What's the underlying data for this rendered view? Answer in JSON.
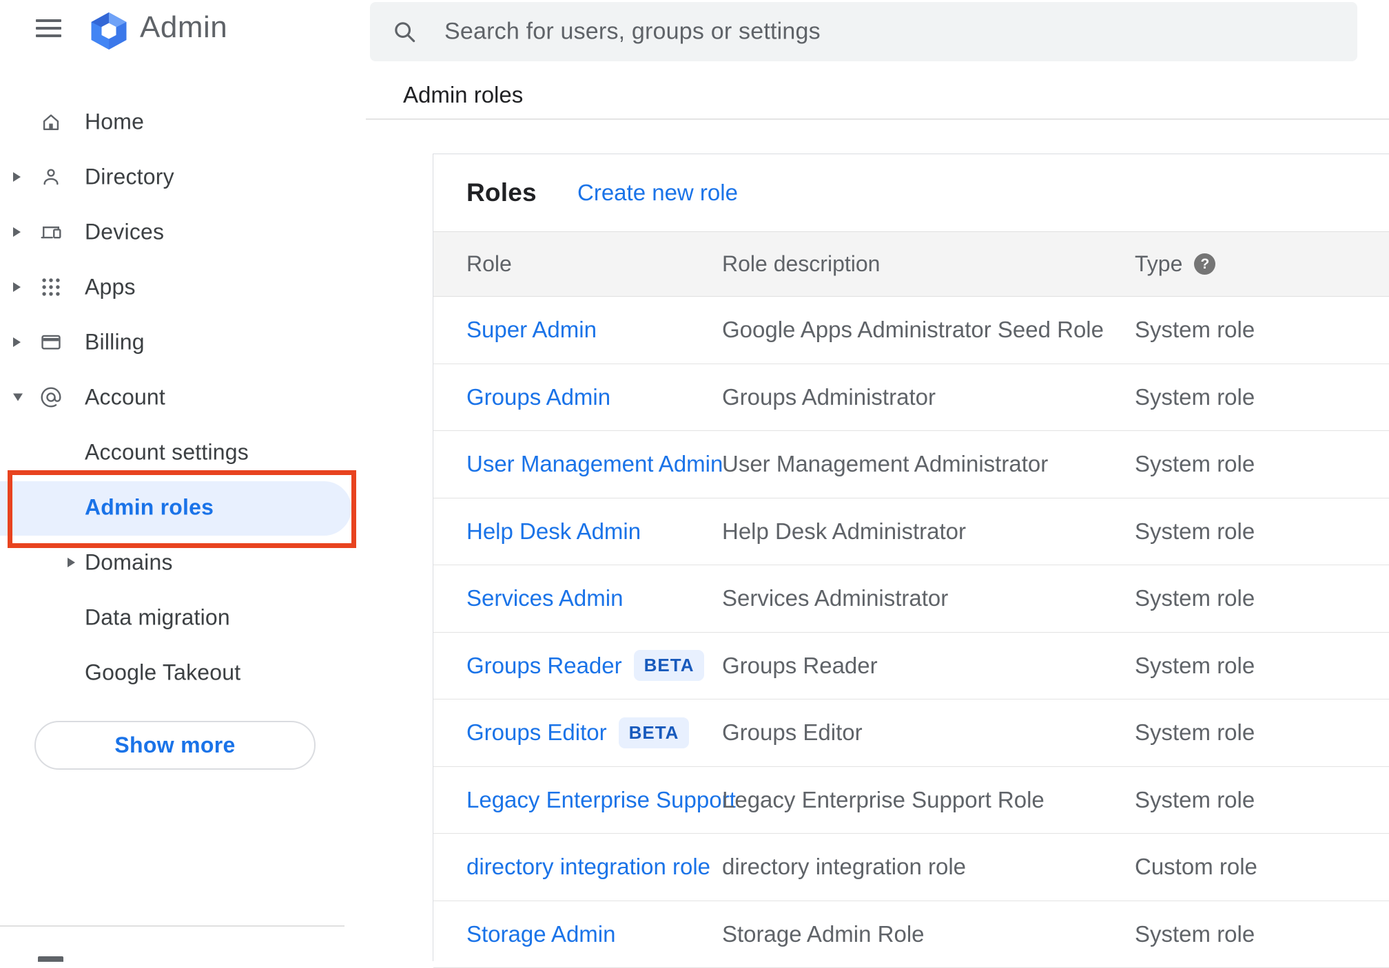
{
  "app": {
    "title": "Admin"
  },
  "search": {
    "placeholder": "Search for users, groups or settings"
  },
  "breadcrumb": "Admin roles",
  "sidebar": {
    "items": [
      {
        "label": "Home",
        "icon": "home",
        "arrow": "none"
      },
      {
        "label": "Directory",
        "icon": "person",
        "arrow": "right"
      },
      {
        "label": "Devices",
        "icon": "devices",
        "arrow": "right"
      },
      {
        "label": "Apps",
        "icon": "apps",
        "arrow": "right"
      },
      {
        "label": "Billing",
        "icon": "card",
        "arrow": "right"
      },
      {
        "label": "Account",
        "icon": "at",
        "arrow": "down"
      }
    ],
    "sub_items": [
      {
        "label": "Account settings",
        "arrow": "none",
        "active": false
      },
      {
        "label": "Admin roles",
        "arrow": "none",
        "active": true
      },
      {
        "label": "Domains",
        "arrow": "right",
        "active": false
      },
      {
        "label": "Data migration",
        "arrow": "none",
        "active": false
      },
      {
        "label": "Google Takeout",
        "arrow": "none",
        "active": false
      }
    ],
    "show_more_label": "Show more"
  },
  "annotation": {
    "type": "highlight-box",
    "target": "Admin roles",
    "color": "#e8431f"
  },
  "roles_card": {
    "title": "Roles",
    "create_link": "Create new role",
    "columns": [
      "Role",
      "Role description",
      "Type"
    ],
    "rows": [
      {
        "role": "Super Admin",
        "beta": false,
        "description": "Google Apps Administrator Seed Role",
        "type": "System role"
      },
      {
        "role": "Groups Admin",
        "beta": false,
        "description": "Groups Administrator",
        "type": "System role"
      },
      {
        "role": "User Management Admin",
        "beta": false,
        "description": "User Management Administrator",
        "type": "System role"
      },
      {
        "role": "Help Desk Admin",
        "beta": false,
        "description": "Help Desk Administrator",
        "type": "System role"
      },
      {
        "role": "Services Admin",
        "beta": false,
        "description": "Services Administrator",
        "type": "System role"
      },
      {
        "role": "Groups Reader",
        "beta": true,
        "description": "Groups Reader",
        "type": "System role"
      },
      {
        "role": "Groups Editor",
        "beta": true,
        "description": "Groups Editor",
        "type": "System role"
      },
      {
        "role": "Legacy Enterprise Support",
        "beta": false,
        "description": "Legacy Enterprise Support Role",
        "type": "System role"
      },
      {
        "role": "directory integration role",
        "beta": false,
        "description": "directory integration role",
        "type": "Custom role"
      },
      {
        "role": "Storage Admin",
        "beta": false,
        "description": "Storage Admin Role",
        "type": "System role"
      }
    ],
    "beta_label": "BETA"
  },
  "colors": {
    "link_blue": "#1a73e8",
    "active_item_bg": "#e8f0fe",
    "beta_text": "#185abc",
    "beta_bg": "#e8f0fe",
    "annotation_red": "#e8431f",
    "logo_blue": "#4285f4",
    "table_header_bg": "#f4f4f4",
    "searchbar_bg": "#f1f3f4"
  }
}
